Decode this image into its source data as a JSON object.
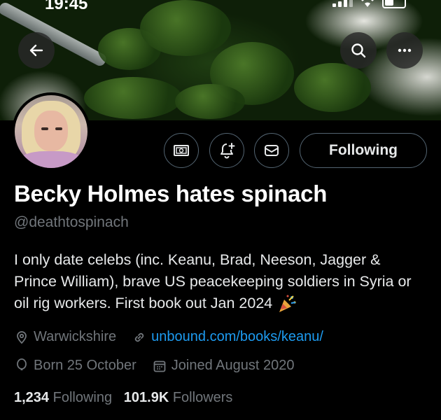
{
  "status": {
    "time": "19:45"
  },
  "header": {
    "back": "back-icon",
    "search": "search-icon",
    "more": "more-icon"
  },
  "profile": {
    "name": "Becky Holmes hates spinach",
    "handle": "@deathtospinach",
    "bio": "I only date celebs (inc. Keanu, Brad, Neeson, Jagger & Prince William), brave US peacekeeping soldiers in Syria or oil rig workers. First book out Jan 2024",
    "location": "Warwickshire",
    "website": "unbound.com/books/keanu/",
    "birthday": "Born 25 October",
    "joined": "Joined August 2020",
    "following_count": "1,234",
    "following_label": "Following",
    "followers_count": "101.9K",
    "followers_label": "Followers"
  },
  "actions": {
    "following_button": "Following"
  },
  "colors": {
    "link": "#1d9bf0",
    "muted": "#71767b",
    "text": "#e7e9ea",
    "background": "#000000"
  }
}
